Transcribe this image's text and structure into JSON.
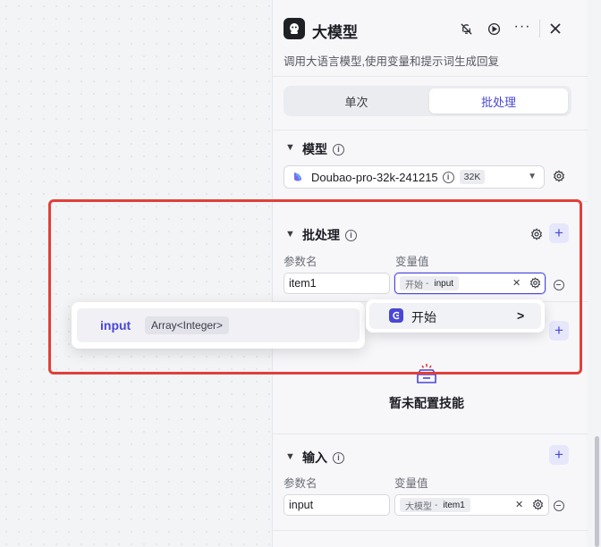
{
  "node": {
    "title": "大模型",
    "description": "调用大语言模型,使用变量和提示词生成回复"
  },
  "tabs": [
    {
      "label": "单次",
      "active": false
    },
    {
      "label": "批处理",
      "active": true
    }
  ],
  "model_section": {
    "title": "模型",
    "model_name": "Doubao-pro-32k-241215",
    "context_badge": "32K"
  },
  "batch_section": {
    "title": "批处理",
    "param_header": "参数名",
    "value_header": "变量值",
    "param_value": "item1",
    "ref_node": "开始",
    "ref_separator": "-",
    "ref_var": "input"
  },
  "skills_section": {
    "empty_text": "暂未配置技能"
  },
  "input_section": {
    "title": "输入",
    "param_header": "参数名",
    "value_header": "变量值",
    "param_value": "input",
    "ref_node": "大模型",
    "ref_separator": "-",
    "ref_var": "item1"
  },
  "variable_popup": {
    "var_name": "input",
    "var_type": "Array<Integer>"
  },
  "node_popup": {
    "label": "开始"
  },
  "colors": {
    "accent": "#4a47d6",
    "highlight_border": "#e0403a"
  }
}
